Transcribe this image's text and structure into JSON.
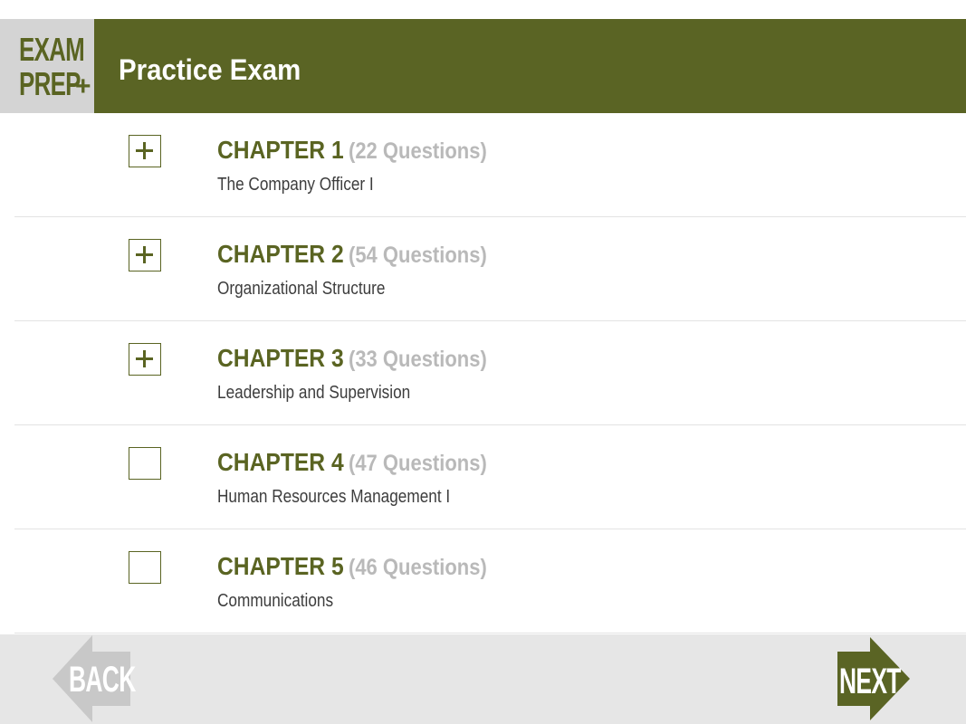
{
  "header": {
    "logo_line1": "EXAM",
    "logo_line2": "PREP",
    "logo_plus": "+",
    "title": "Practice Exam"
  },
  "chapters": [
    {
      "label": "CHAPTER 1",
      "questions": "(22 Questions)",
      "title": "The Company Officer I",
      "expanded_marker": true
    },
    {
      "label": "CHAPTER 2",
      "questions": "(54 Questions)",
      "title": "Organizational Structure",
      "expanded_marker": true
    },
    {
      "label": "CHAPTER 3",
      "questions": "(33 Questions)",
      "title": "Leadership and Supervision",
      "expanded_marker": true
    },
    {
      "label": "CHAPTER 4",
      "questions": "(47 Questions)",
      "title": "Human Resources Management I",
      "expanded_marker": false
    },
    {
      "label": "CHAPTER 5",
      "questions": "(46 Questions)",
      "title": "Communications",
      "expanded_marker": false
    }
  ],
  "footer": {
    "back_label": "BACK",
    "next_label": "NEXT"
  },
  "colors": {
    "brand_green": "#5a6424",
    "muted_gray": "#b9b9b9",
    "back_arrow": "#c8c8c8"
  },
  "icons": {
    "checkbox_plus": "plus-icon",
    "back": "left-arrow-icon",
    "next": "right-arrow-icon"
  }
}
